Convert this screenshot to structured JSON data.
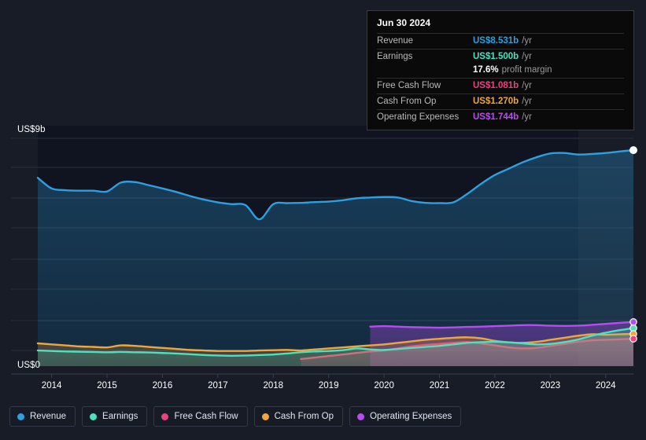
{
  "theme": {
    "background": "#171c27",
    "plot_background": "#0f1420",
    "gridline": "#2b303c",
    "axis_text": "#ffffff"
  },
  "axes": {
    "y_top_label": "US$9b",
    "y_bottom_label": "US$0",
    "x_ticks": [
      "2014",
      "2015",
      "2016",
      "2017",
      "2018",
      "2019",
      "2020",
      "2021",
      "2022",
      "2023",
      "2024"
    ]
  },
  "tooltip": {
    "date": "Jun 30 2024",
    "rows": [
      {
        "name": "Revenue",
        "value": "US$8.531b",
        "unit": "/yr",
        "color": "#2e9fe0"
      },
      {
        "name": "Earnings",
        "value": "US$1.500b",
        "unit": "/yr",
        "color": "#4fe0c0"
      },
      {
        "name": "",
        "value": "17.6%",
        "unit": "profit margin",
        "color": "#ffffff"
      },
      {
        "name": "Free Cash Flow",
        "value": "US$1.081b",
        "unit": "/yr",
        "color": "#e8437f"
      },
      {
        "name": "Cash From Op",
        "value": "US$1.270b",
        "unit": "/yr",
        "color": "#efa63c"
      },
      {
        "name": "Operating Expenses",
        "value": "US$1.744b",
        "unit": "/yr",
        "color": "#b74cf0"
      }
    ]
  },
  "legend": {
    "items": [
      {
        "label": "Revenue",
        "color": "#2e9fe0"
      },
      {
        "label": "Earnings",
        "color": "#4fe0c0"
      },
      {
        "label": "Free Cash Flow",
        "color": "#e8437f"
      },
      {
        "label": "Cash From Op",
        "color": "#efa63c"
      },
      {
        "label": "Operating Expenses",
        "color": "#b74cf0"
      }
    ]
  },
  "chart_data": {
    "type": "area",
    "title": "",
    "xlabel": "",
    "ylabel": "US$",
    "ylim": [
      0,
      9
    ],
    "xlim": [
      "2013-09",
      "2024-06"
    ],
    "grid": true,
    "legend_position": "bottom",
    "y_unit": "US$ billions per year",
    "x": [
      "2013.75",
      "2014.0",
      "2014.25",
      "2014.5",
      "2014.75",
      "2015.0",
      "2015.25",
      "2015.5",
      "2015.75",
      "2016.0",
      "2016.25",
      "2016.5",
      "2016.75",
      "2017.0",
      "2017.25",
      "2017.5",
      "2017.75",
      "2018.0",
      "2018.25",
      "2018.5",
      "2018.75",
      "2019.0",
      "2019.25",
      "2019.5",
      "2019.75",
      "2020.0",
      "2020.25",
      "2020.5",
      "2020.75",
      "2021.0",
      "2021.25",
      "2021.5",
      "2021.75",
      "2022.0",
      "2022.25",
      "2022.5",
      "2022.75",
      "2023.0",
      "2023.25",
      "2023.5",
      "2023.75",
      "2024.0",
      "2024.25",
      "2024.5"
    ],
    "series": [
      {
        "name": "Revenue",
        "color": "#2e9fe0",
        "values": [
          7.44,
          7.02,
          6.95,
          6.93,
          6.93,
          6.9,
          7.25,
          7.27,
          7.15,
          7.02,
          6.88,
          6.72,
          6.58,
          6.47,
          6.4,
          6.36,
          5.8,
          6.4,
          6.44,
          6.45,
          6.48,
          6.5,
          6.55,
          6.63,
          6.66,
          6.68,
          6.66,
          6.52,
          6.45,
          6.44,
          6.47,
          6.8,
          7.2,
          7.55,
          7.8,
          8.05,
          8.25,
          8.4,
          8.42,
          8.36,
          8.38,
          8.42,
          8.48,
          8.531
        ]
      },
      {
        "name": "Earnings",
        "color": "#4fe0c0",
        "values": [
          0.62,
          0.6,
          0.58,
          0.57,
          0.56,
          0.55,
          0.56,
          0.55,
          0.54,
          0.52,
          0.5,
          0.47,
          0.44,
          0.42,
          0.41,
          0.42,
          0.44,
          0.46,
          0.5,
          0.55,
          0.58,
          0.6,
          0.63,
          0.7,
          0.66,
          0.64,
          0.68,
          0.72,
          0.76,
          0.8,
          0.86,
          0.92,
          0.95,
          0.96,
          0.94,
          0.9,
          0.86,
          0.88,
          0.95,
          1.05,
          1.2,
          1.32,
          1.42,
          1.5
        ]
      },
      {
        "name": "Free Cash Flow",
        "color": "#e8437f",
        "values": [
          null,
          null,
          null,
          null,
          null,
          null,
          null,
          null,
          null,
          null,
          null,
          null,
          null,
          null,
          null,
          null,
          null,
          null,
          null,
          0.28,
          0.34,
          0.4,
          0.46,
          0.52,
          0.58,
          0.62,
          0.7,
          0.78,
          0.84,
          0.88,
          0.92,
          0.95,
          0.9,
          0.82,
          0.74,
          0.7,
          0.72,
          0.8,
          0.88,
          0.96,
          1.02,
          1.04,
          1.06,
          1.081
        ]
      },
      {
        "name": "Cash From Op",
        "color": "#efa63c",
        "values": [
          0.9,
          0.86,
          0.82,
          0.78,
          0.76,
          0.74,
          0.82,
          0.8,
          0.76,
          0.72,
          0.68,
          0.64,
          0.62,
          0.6,
          0.6,
          0.6,
          0.62,
          0.63,
          0.64,
          0.62,
          0.66,
          0.7,
          0.74,
          0.78,
          0.82,
          0.86,
          0.92,
          0.98,
          1.04,
          1.08,
          1.12,
          1.14,
          1.1,
          1.0,
          0.94,
          0.92,
          0.96,
          1.04,
          1.12,
          1.2,
          1.26,
          1.24,
          1.26,
          1.27
        ]
      },
      {
        "name": "Operating Expenses",
        "color": "#b74cf0",
        "values": [
          null,
          null,
          null,
          null,
          null,
          null,
          null,
          null,
          null,
          null,
          null,
          null,
          null,
          null,
          null,
          null,
          null,
          null,
          null,
          null,
          null,
          null,
          null,
          null,
          1.56,
          1.58,
          1.56,
          1.54,
          1.53,
          1.52,
          1.53,
          1.55,
          1.56,
          1.58,
          1.6,
          1.62,
          1.62,
          1.6,
          1.59,
          1.6,
          1.63,
          1.67,
          1.71,
          1.744
        ]
      }
    ],
    "end_markers": [
      {
        "series": "Revenue",
        "value": 8.531,
        "color": "#ffffff"
      },
      {
        "series": "Operating Expenses",
        "value": 1.744,
        "color": "#b74cf0"
      },
      {
        "series": "Earnings",
        "value": 1.5,
        "color": "#4fe0c0"
      },
      {
        "series": "Cash From Op",
        "value": 1.27,
        "color": "#efa63c"
      },
      {
        "series": "Free Cash Flow",
        "value": 1.081,
        "color": "#e8437f"
      }
    ]
  }
}
